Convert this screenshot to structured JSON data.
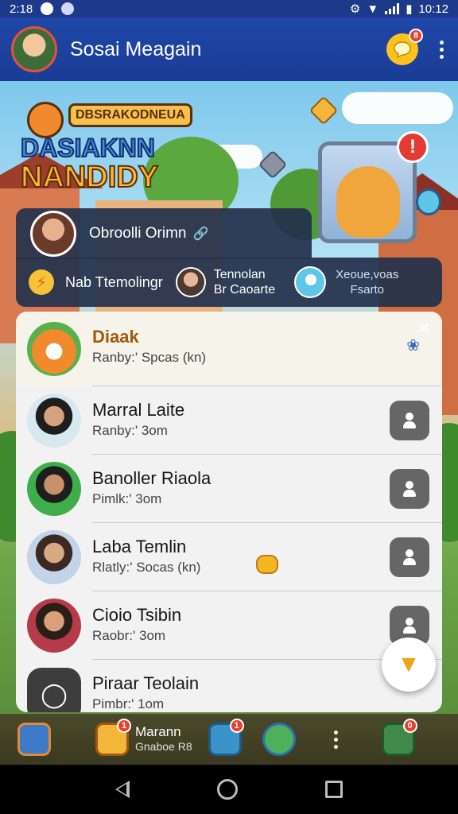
{
  "status_bar": {
    "time": "2:18",
    "clock": "10:12"
  },
  "app_bar": {
    "title": "Sosai Meagain",
    "chat_badge": "8"
  },
  "banner": {
    "logo_top": "DBSRAKODNEUA",
    "logo_line1": "DASIAKNN",
    "logo_line2": "NANDIDY",
    "alert_glyph": "!"
  },
  "featured": {
    "name": "Obroolli Orimn",
    "item1": "Nab Ttemolingr",
    "item2_line1": "Tennolan",
    "item2_line2": "Br Caoarte",
    "item3_line1": "Xeoue,voas",
    "item3_line2": "Fsarto"
  },
  "contacts": [
    {
      "name": "Diaak",
      "status": "Ranby:' Spcas (kn)"
    },
    {
      "name": "Marral Laite",
      "status": "Ranby:' 3om"
    },
    {
      "name": "Banoller Riaola",
      "status": "Pimlk:' 3om"
    },
    {
      "name": "Laba Temlin",
      "status": "Rlatly:' Socas (kn)"
    },
    {
      "name": "Cioio Tsibin",
      "status": "Raobr:' 3om"
    },
    {
      "name": "Piraar Teolain",
      "status": "Pimbr:' 1om"
    }
  ],
  "bottom_bar": {
    "label": "Marann",
    "sublabel": "Gnaboe R8",
    "badge1": "1",
    "badge2": "1",
    "badge3": "0"
  },
  "colors": {
    "app_bar": "#1f47a8",
    "accent_orange": "#f0a418",
    "badge_red": "#e8402e",
    "card_bg": "#f2f2f2"
  }
}
